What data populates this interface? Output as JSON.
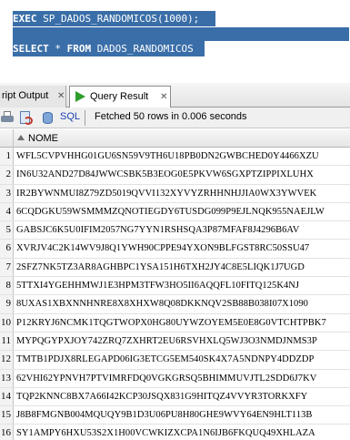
{
  "editor": {
    "line1": {
      "keyword": "EXEC",
      "rest": " SP_DADOS_RANDOMICOS(1000);"
    },
    "line2": {
      "keyword1": "SELECT",
      "middle": " * ",
      "keyword2": "FROM",
      "rest": " DADOS_RANDOMICOS"
    }
  },
  "tabs": [
    {
      "label": "ript Output",
      "close": "✕"
    },
    {
      "label": "Query Result",
      "close": "✕"
    }
  ],
  "toolbar": {
    "sql_label": "SQL",
    "separator": "|",
    "status": "Fetched 50 rows in 0.006 seconds"
  },
  "grid": {
    "column": "NOME",
    "rows": [
      {
        "n": "1",
        "v": "WFL5CVPVHHG01GU6SN59V9TH6U18PB0DN2GWBCHED0Y4466XZU"
      },
      {
        "n": "2",
        "v": "IN6U32AND27D84JWWCSBK5B3EOG0E5PKVW6SGXPTZIPPIXLUHX"
      },
      {
        "n": "3",
        "v": "IR2BYWNMUI8Z79ZD5019QVVI132XYVYZRHHNHJJIA0WX3YWVEK"
      },
      {
        "n": "4",
        "v": "6CQDGKU59WSMMMZQNOTIEGDY6TUSDG099P9EJLNQK955NAEJLW"
      },
      {
        "n": "5",
        "v": "GABSJC6K5U0IFIM2057NG7YYN1RSHSQA3P87MFAF8J4296B6AV"
      },
      {
        "n": "6",
        "v": "XVRJV4C2K14WV9J8Q1YWH90CPPE94YXON9BLFGST8RC50SSU47"
      },
      {
        "n": "7",
        "v": "2SFZ7NK5TZ3AR8AGHBPC1YSA151H6TXH2JY4C8E5LIQK1J7UGD"
      },
      {
        "n": "8",
        "v": "5TTXI4YGEHHMWJ1E3HPM3TFW3HO5II6AQQFL10FITQ125K4NJ"
      },
      {
        "n": "9",
        "v": "8UXAS1XBXNNHNRE8X8XHXW8Q08DKKNQV2SB88B038I07X1090"
      },
      {
        "n": "10",
        "v": "P12KRYJ6NCMK1TQGTWOPX0HG80UYWZOYEM5E0E8G0VTCHTPBK7"
      },
      {
        "n": "11",
        "v": "MYPQGYPXJOY742ZRQ7ZXHRT2EU6RSVHXLQ5WJ3O3NMDJNMS3P"
      },
      {
        "n": "12",
        "v": "TMTB1PDJX8RLEGAPD06IG3ETCG5EM540SK4X7A5NDNPY4DDZDP"
      },
      {
        "n": "13",
        "v": "62VHI62YPNVH7PTVIMRFDQ0VGKGRSQ5BHIMMUVJTL2SDD6J7KV"
      },
      {
        "n": "14",
        "v": "TQP2KNNC8BX7A66I42KCP30JSQX831G9HITQZ4VVYR3TORKXFY"
      },
      {
        "n": "15",
        "v": "J8B8FMGNB004MQUQY9B1D3U06PU8H80GHE9WVY64EN9HLT113B"
      },
      {
        "n": "16",
        "v": "SY1AMPY6HXU53S2X1H00VCWKIZXCPA1N6IJB6FKQUQ49XHLAZA"
      }
    ]
  },
  "colors": {
    "selection": "#3a6ea8",
    "run_icon": "#2e9e2e",
    "sql_link": "#1a3fb0"
  },
  "icons": [
    "close-icon",
    "run-icon",
    "print-icon",
    "refresh-icon",
    "sql-icon",
    "sort-icon"
  ]
}
